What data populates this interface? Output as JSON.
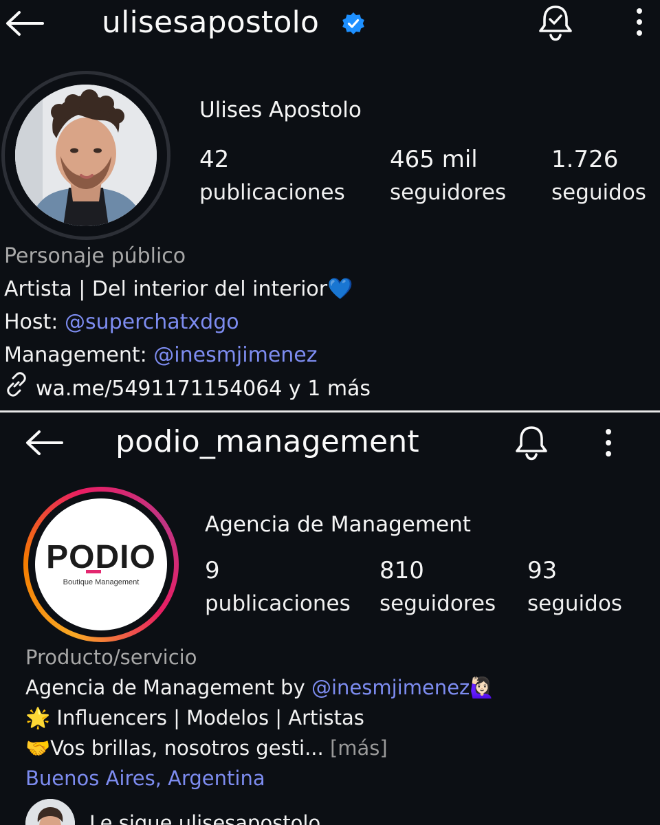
{
  "profile1": {
    "username": "ulisesapostolo",
    "verified_color": "#1e90ff",
    "header_icons": [
      "back-arrow-icon",
      "bell-check-icon",
      "more-vertical-icon"
    ],
    "full_name": "Ulises Apostolo",
    "stats": [
      {
        "value": "42",
        "label": "publicaciones"
      },
      {
        "value": "465 mil",
        "label": "seguidores"
      },
      {
        "value": "1.726",
        "label": "seguidos"
      }
    ],
    "category": "Personaje público",
    "bio_line1": "Artista | Del interior del interior",
    "bio_line1_emoji": "💙",
    "bio_host_label": "Host: ",
    "bio_host_mention": "@superchatxdgo",
    "bio_mgmt_label": "Management: ",
    "bio_mgmt_mention": "@inesmjimenez",
    "link": "wa.me/5491171154064 y 1 más"
  },
  "profile2": {
    "username": "podio_management",
    "header_icons": [
      "back-arrow-icon",
      "bell-icon",
      "more-vertical-icon"
    ],
    "logo_text": "PODIO",
    "logo_subtext": "Boutique Management",
    "full_name": "Agencia de Management",
    "stats": [
      {
        "value": "9",
        "label": "publicaciones"
      },
      {
        "value": "810",
        "label": "seguidores"
      },
      {
        "value": "93",
        "label": "seguidos"
      }
    ],
    "category": "Producto/servicio",
    "bio_line1_text": "Agencia de Management by ",
    "bio_line1_mention": "@inesmjimenez",
    "bio_line1_emoji": "🙋🏻‍♀️",
    "bio_line2_emoji": "🌟",
    "bio_line2_text": " Influencers | Modelos | Artistas",
    "bio_line3_emoji": "🤝",
    "bio_line3_text": "Vos brillas, nosotros gesti... ",
    "bio_line3_more": "[más]",
    "location": "Buenos Aires, Argentina",
    "followed_by": "Le sigue ulisesapostolo"
  },
  "colors": {
    "background": "#0c0f14",
    "mention": "#7d8cf0",
    "muted": "#a8a8a8",
    "story_ring_gradient": [
      "#f9a825",
      "#e91e63",
      "#c13584",
      "#8a3ab9"
    ]
  }
}
